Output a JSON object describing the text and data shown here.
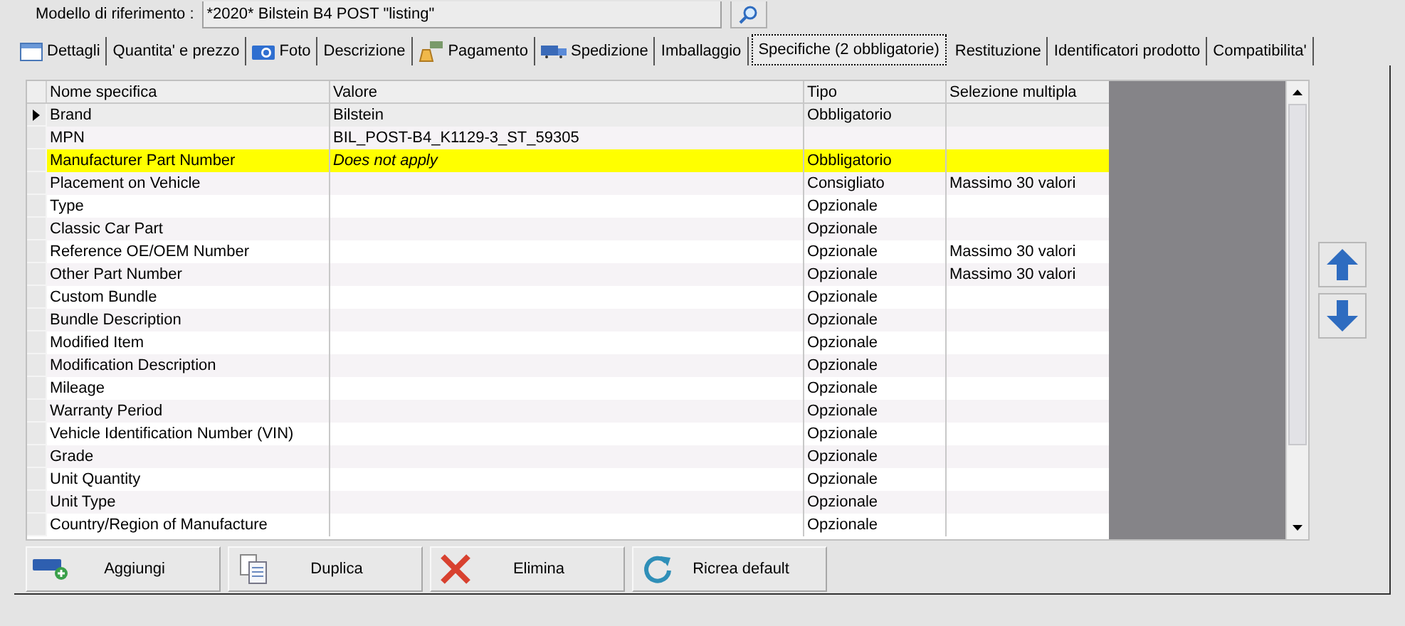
{
  "reference": {
    "label": "Modello di riferimento :",
    "value": "*2020* Bilstein B4 POST \"listing\""
  },
  "tabs": [
    {
      "label": "Dettagli",
      "kind": "window",
      "selected": false
    },
    {
      "label": "Quantita' e prezzo",
      "kind": "text",
      "selected": false
    },
    {
      "label": "Foto",
      "kind": "camera",
      "selected": false
    },
    {
      "label": "Descrizione",
      "kind": "text",
      "selected": false
    },
    {
      "label": "Pagamento",
      "kind": "payment",
      "selected": false
    },
    {
      "label": "Spedizione",
      "kind": "truck",
      "selected": false
    },
    {
      "label": "Imballaggio",
      "kind": "text",
      "selected": false
    },
    {
      "label": "Specifiche (2 obbligatorie)",
      "kind": "text",
      "selected": true
    },
    {
      "label": "Restituzione",
      "kind": "text",
      "selected": false
    },
    {
      "label": "Identificatori prodotto",
      "kind": "text",
      "selected": false
    },
    {
      "label": "Compatibilita'",
      "kind": "text",
      "selected": false
    }
  ],
  "table": {
    "columns": [
      "Nome specifica",
      "Valore",
      "Tipo",
      "Selezione multipla"
    ],
    "rows": [
      {
        "name": "Brand",
        "value": "Bilstein",
        "type": "Obbligatorio",
        "multi": "",
        "selected": true,
        "highlighted": false,
        "italic_value": false
      },
      {
        "name": "MPN",
        "value": "BIL_POST-B4_K1129-3_ST_59305",
        "type": "",
        "multi": "",
        "selected": false,
        "highlighted": false,
        "italic_value": false
      },
      {
        "name": "Manufacturer Part Number",
        "value": "Does not apply",
        "type": "Obbligatorio",
        "multi": "",
        "selected": false,
        "highlighted": true,
        "italic_value": true
      },
      {
        "name": "Placement on Vehicle",
        "value": "",
        "type": "Consigliato",
        "multi": "Massimo 30 valori",
        "selected": false,
        "highlighted": false
      },
      {
        "name": "Type",
        "value": "",
        "type": "Opzionale",
        "multi": "",
        "selected": false,
        "highlighted": false
      },
      {
        "name": "Classic Car Part",
        "value": "",
        "type": "Opzionale",
        "multi": "",
        "selected": false,
        "highlighted": false
      },
      {
        "name": "Reference OE/OEM Number",
        "value": "",
        "type": "Opzionale",
        "multi": "Massimo 30 valori",
        "selected": false,
        "highlighted": false
      },
      {
        "name": "Other Part Number",
        "value": "",
        "type": "Opzionale",
        "multi": "Massimo 30 valori",
        "selected": false,
        "highlighted": false
      },
      {
        "name": "Custom Bundle",
        "value": "",
        "type": "Opzionale",
        "multi": "",
        "selected": false,
        "highlighted": false
      },
      {
        "name": "Bundle Description",
        "value": "",
        "type": "Opzionale",
        "multi": "",
        "selected": false,
        "highlighted": false
      },
      {
        "name": "Modified Item",
        "value": "",
        "type": "Opzionale",
        "multi": "",
        "selected": false,
        "highlighted": false
      },
      {
        "name": "Modification Description",
        "value": "",
        "type": "Opzionale",
        "multi": "",
        "selected": false,
        "highlighted": false
      },
      {
        "name": "Mileage",
        "value": "",
        "type": "Opzionale",
        "multi": "",
        "selected": false,
        "highlighted": false
      },
      {
        "name": "Warranty Period",
        "value": "",
        "type": "Opzionale",
        "multi": "",
        "selected": false,
        "highlighted": false
      },
      {
        "name": "Vehicle Identification Number (VIN)",
        "value": "",
        "type": "Opzionale",
        "multi": "",
        "selected": false,
        "highlighted": false
      },
      {
        "name": "Grade",
        "value": "",
        "type": "Opzionale",
        "multi": "",
        "selected": false,
        "highlighted": false
      },
      {
        "name": "Unit Quantity",
        "value": "",
        "type": "Opzionale",
        "multi": "",
        "selected": false,
        "highlighted": false
      },
      {
        "name": "Unit Type",
        "value": "",
        "type": "Opzionale",
        "multi": "",
        "selected": false,
        "highlighted": false
      },
      {
        "name": "Country/Region of Manufacture",
        "value": "",
        "type": "Opzionale",
        "multi": "",
        "selected": false,
        "highlighted": false
      }
    ]
  },
  "buttons": [
    {
      "label": "Aggiungi",
      "kind": "add"
    },
    {
      "label": "Duplica",
      "kind": "copy"
    },
    {
      "label": "Elimina",
      "kind": "delete"
    },
    {
      "label": "Ricrea default",
      "kind": "refresh"
    }
  ]
}
